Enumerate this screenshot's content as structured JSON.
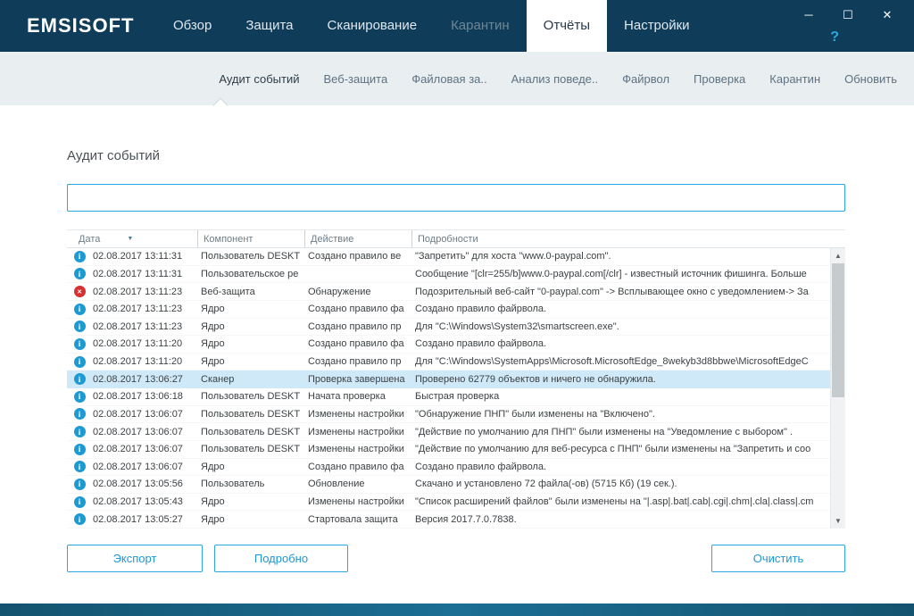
{
  "brand": {
    "logo": "EMSISOFT"
  },
  "window_controls": {
    "minimize": "─",
    "maximize": "☐",
    "close": "✕",
    "help": "?"
  },
  "main_nav": {
    "items": [
      {
        "label": "Обзор",
        "state": "normal"
      },
      {
        "label": "Защита",
        "state": "normal"
      },
      {
        "label": "Сканирование",
        "state": "normal"
      },
      {
        "label": "Карантин",
        "state": "disabled"
      },
      {
        "label": "Отчёты",
        "state": "active"
      },
      {
        "label": "Настройки",
        "state": "normal"
      }
    ]
  },
  "sub_nav": {
    "items": [
      {
        "label": "Аудит событий",
        "active": true
      },
      {
        "label": "Веб-защита",
        "active": false
      },
      {
        "label": "Файловая за..",
        "active": false
      },
      {
        "label": "Анализ поведе..",
        "active": false
      },
      {
        "label": "Файрвол",
        "active": false
      },
      {
        "label": "Проверка",
        "active": false
      },
      {
        "label": "Карантин",
        "active": false
      },
      {
        "label": "Обновить",
        "active": false
      }
    ]
  },
  "page": {
    "title": "Аудит событий"
  },
  "search": {
    "value": "",
    "placeholder": ""
  },
  "table": {
    "columns": [
      "Дата",
      "Компонент",
      "Действие",
      "Подробности"
    ],
    "sort_indicator": "▼",
    "sort": {
      "column": "Дата",
      "direction": "desc"
    },
    "rows": [
      {
        "icon": "info",
        "selected": false,
        "date": "02.08.2017 13:11:31",
        "component": "Пользователь DESKT",
        "action": "Создано правило ве",
        "details": "\"Запретить\" для хоста \"www.0-paypal.com\"."
      },
      {
        "icon": "info",
        "selected": false,
        "date": "02.08.2017 13:11:31",
        "component": "Пользовательское ре",
        "action": "",
        "details": "Сообщение \"[clr=255/b]www.0-paypal.com[/clr] - известный источник фишинга. Больше"
      },
      {
        "icon": "error",
        "selected": false,
        "date": "02.08.2017 13:11:23",
        "component": "Веб-защита",
        "action": "Обнаружение",
        "details": "Подозрительный веб-сайт \"0-paypal.com\" ->  Всплывающее окно с уведомлением-> За"
      },
      {
        "icon": "info",
        "selected": false,
        "date": "02.08.2017 13:11:23",
        "component": "Ядро",
        "action": "Создано правило фа",
        "details": "Создано правило файрвола."
      },
      {
        "icon": "info",
        "selected": false,
        "date": "02.08.2017 13:11:23",
        "component": "Ядро",
        "action": "Создано правило пр",
        "details": "Для \"C:\\Windows\\System32\\smartscreen.exe\"."
      },
      {
        "icon": "info",
        "selected": false,
        "date": "02.08.2017 13:11:20",
        "component": "Ядро",
        "action": "Создано правило фа",
        "details": "Создано правило файрвола."
      },
      {
        "icon": "info",
        "selected": false,
        "date": "02.08.2017 13:11:20",
        "component": "Ядро",
        "action": "Создано правило пр",
        "details": "Для \"C:\\Windows\\SystemApps\\Microsoft.MicrosoftEdge_8wekyb3d8bbwe\\MicrosoftEdgeC"
      },
      {
        "icon": "info",
        "selected": true,
        "date": "02.08.2017 13:06:27",
        "component": "Сканер",
        "action": "Проверка завершена",
        "details": "Проверено 62779 объектов и ничего не обнаружила."
      },
      {
        "icon": "info",
        "selected": false,
        "date": "02.08.2017 13:06:18",
        "component": "Пользователь DESKT",
        "action": "Начата проверка",
        "details": "Быстрая проверка"
      },
      {
        "icon": "info",
        "selected": false,
        "date": "02.08.2017 13:06:07",
        "component": "Пользователь DESKT",
        "action": "Изменены настройки",
        "details": "\"Обнаружение ПНП\" были изменены на \"Включено\"."
      },
      {
        "icon": "info",
        "selected": false,
        "date": "02.08.2017 13:06:07",
        "component": "Пользователь DESKT",
        "action": "Изменены настройки",
        "details": "\"Действие по умолчанию для ПНП\" были изменены на \"Уведомление с выбором\" ."
      },
      {
        "icon": "info",
        "selected": false,
        "date": "02.08.2017 13:06:07",
        "component": "Пользователь DESKT",
        "action": "Изменены настройки",
        "details": "\"Действие по умолчанию для веб-ресурса с ПНП\" были изменены на \"Запретить и соо"
      },
      {
        "icon": "info",
        "selected": false,
        "date": "02.08.2017 13:06:07",
        "component": "Ядро",
        "action": "Создано правило фа",
        "details": "Создано правило файрвола."
      },
      {
        "icon": "info",
        "selected": false,
        "date": "02.08.2017 13:05:56",
        "component": "Пользователь",
        "action": "Обновление",
        "details": "Скачано и установлено 72 файла(-ов) (5715 Кб) (19 сек.)."
      },
      {
        "icon": "info",
        "selected": false,
        "date": "02.08.2017 13:05:43",
        "component": "Ядро",
        "action": "Изменены настройки",
        "details": "\"Список расширений файлов\" были изменены на \"|.asp|.bat|.cab|.cgi|.chm|.cla|.class|.cm"
      },
      {
        "icon": "info",
        "selected": false,
        "date": "02.08.2017 13:05:27",
        "component": "Ядро",
        "action": "Стартовала защита",
        "details": "Версия 2017.7.0.7838."
      }
    ]
  },
  "footer_buttons": {
    "export": "Экспорт",
    "details": "Подробно",
    "clear": "Очистить"
  },
  "colors": {
    "accent": "#2BA6DF",
    "header_bg": "#0F3C59",
    "selected_row": "#CFE9F8",
    "info_icon": "#1E9AD2",
    "error_icon": "#D63031"
  }
}
